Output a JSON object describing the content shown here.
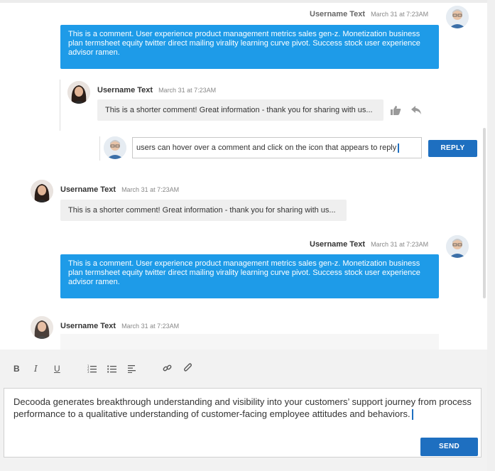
{
  "comments": {
    "c1": {
      "username": "Username Text",
      "time": "March 31 at 7:23AM",
      "text": "This is a comment.  User experience product management metrics sales gen-z. Monetization business plan termsheet equity twitter direct mailing virality learning curve pivot. Success stock user experience advisor ramen."
    },
    "c2": {
      "username": "Username Text",
      "time": "March 31 at 7:23AM",
      "text": "This is a shorter comment! Great information - thank you for sharing with us..."
    },
    "c3": {
      "username": "Username Text",
      "time": "March 31 at 7:23AM",
      "text": "This is a shorter comment! Great information - thank you for sharing with us..."
    },
    "c4": {
      "username": "Username Text",
      "time": "March 31 at 7:23AM",
      "text": "This is a comment.  User experience product management metrics sales gen-z. Monetization business plan termsheet equity twitter direct mailing virality learning curve pivot. Success stock user experience advisor ramen."
    },
    "c5": {
      "username": "Username Text",
      "time": "March 31 at 7:23AM"
    }
  },
  "reply": {
    "value": "users can hover over a comment and click on the icon that appears to reply",
    "button": "REPLY"
  },
  "toolbar": {
    "bold": "B",
    "italic": "I",
    "underline": "U"
  },
  "editor": {
    "value": "Decooda generates breakthrough understanding and visibility into your customers’ support journey from process performance to a qualitative understanding of customer-facing employee attitudes and behaviors.",
    "send": "SEND"
  },
  "icons": [
    "like-icon",
    "reply-arrow-icon",
    "ordered-list-icon",
    "bullet-list-icon",
    "align-left-icon",
    "link-icon",
    "attachment-icon"
  ],
  "colors": {
    "accent_blue": "#1e9be8",
    "button_blue": "#1e6fc0",
    "bubble_gray": "#efefef"
  }
}
